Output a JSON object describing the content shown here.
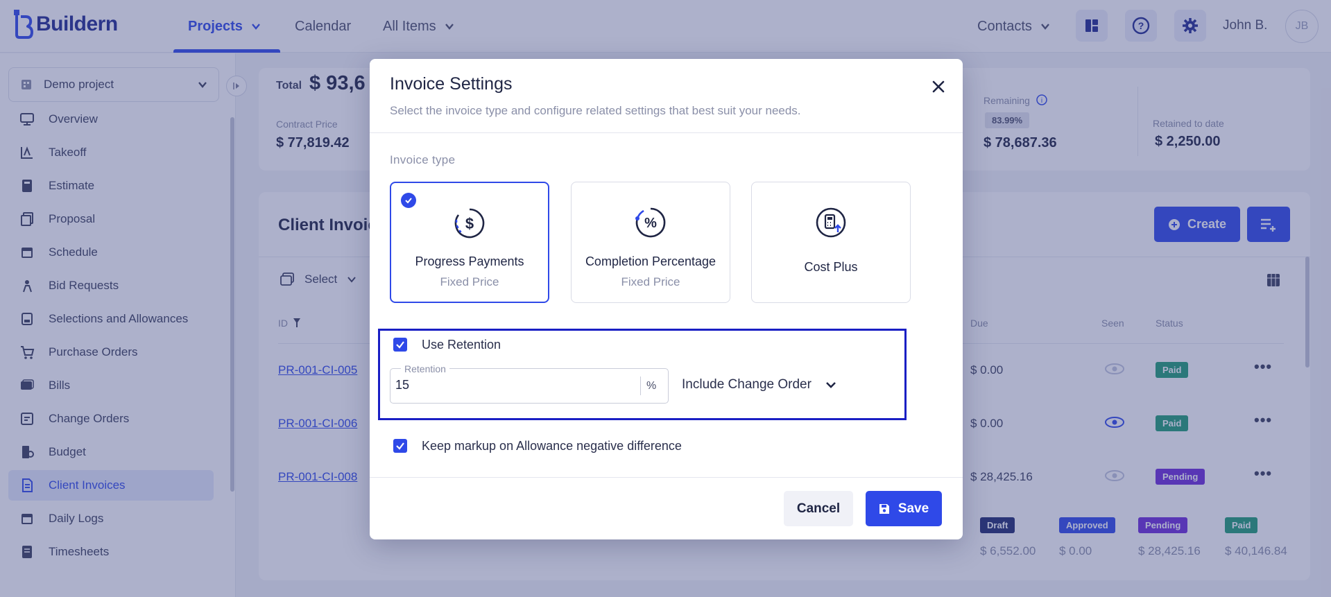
{
  "app": {
    "name": "Buildern"
  },
  "topnav": {
    "items": [
      {
        "label": "Projects"
      },
      {
        "label": "Calendar"
      },
      {
        "label": "All Items"
      }
    ],
    "contacts_label": "Contacts",
    "user_name": "John B.",
    "user_initials": "JB"
  },
  "sidebar": {
    "project_selector": "Demo project",
    "items": [
      {
        "label": "Overview",
        "icon": "monitor-icon"
      },
      {
        "label": "Takeoff",
        "icon": "ruler-icon"
      },
      {
        "label": "Estimate",
        "icon": "calculator-icon"
      },
      {
        "label": "Proposal",
        "icon": "document-stack-icon"
      },
      {
        "label": "Schedule",
        "icon": "calendar-icon"
      },
      {
        "label": "Bid Requests",
        "icon": "bid-icon"
      },
      {
        "label": "Selections and Allowances",
        "icon": "selection-icon"
      },
      {
        "label": "Purchase Orders",
        "icon": "cart-icon"
      },
      {
        "label": "Bills",
        "icon": "bill-icon"
      },
      {
        "label": "Change Orders",
        "icon": "change-icon"
      },
      {
        "label": "Budget",
        "icon": "budget-icon"
      },
      {
        "label": "Client Invoices",
        "icon": "invoice-icon"
      },
      {
        "label": "Daily Logs",
        "icon": "calendar-icon"
      },
      {
        "label": "Timesheets",
        "icon": "timesheet-icon"
      }
    ]
  },
  "summary": {
    "total_label": "Total",
    "total_value": "$ 93,6",
    "contract_price_label": "Contract Price",
    "contract_price_value": "$ 77,819.42",
    "remaining_label": "Remaining",
    "remaining_pct": "83.99%",
    "remaining_value": "$ 78,687.36",
    "retained_label": "Retained to date",
    "retained_value": "$ 2,250.00"
  },
  "invoices": {
    "title": "Client Invoic",
    "create_label": "Create",
    "select_label": "Select",
    "columns": {
      "id": "ID",
      "due": "Due",
      "seen": "Seen",
      "status": "Status"
    },
    "rows": [
      {
        "id": "PR-001-CI-005",
        "due": "$ 0.00",
        "status": "Paid"
      },
      {
        "id": "PR-001-CI-006",
        "due": "$ 0.00",
        "status": "Paid"
      },
      {
        "id": "PR-001-CI-008",
        "due": "$ 28,425.16",
        "status": "Pending"
      }
    ],
    "totals": [
      {
        "label": "Draft",
        "value": "$ 6,552.00"
      },
      {
        "label": "Approved",
        "value": "$ 0.00"
      },
      {
        "label": "Pending",
        "value": "$ 28,425.16"
      },
      {
        "label": "Paid",
        "value": "$ 40,146.84"
      }
    ]
  },
  "modal": {
    "title": "Invoice Settings",
    "subtitle": "Select the invoice type and configure related settings that best suit your needs.",
    "invoice_type_label": "Invoice type",
    "types": [
      {
        "name": "Progress Payments",
        "sub": "Fixed Price",
        "selected": true
      },
      {
        "name": "Completion Percentage",
        "sub": "Fixed Price",
        "selected": false
      },
      {
        "name": "Cost Plus",
        "sub": "",
        "selected": false
      }
    ],
    "use_retention_label": "Use Retention",
    "use_retention_checked": true,
    "retention_field_label": "Retention",
    "retention_value": "15",
    "retention_suffix": "%",
    "include_dropdown_value": "Include Change Order",
    "keep_markup_label": "Keep markup on Allowance negative difference",
    "keep_markup_checked": true,
    "cancel_label": "Cancel",
    "save_label": "Save"
  },
  "colors": {
    "accent": "#2f49e8",
    "highlight_border": "#1a1fc4",
    "badge_paid": "#1f9d74",
    "badge_pending": "#6d2bd9",
    "badge_draft": "#1f2a6e",
    "badge_approved": "#2f49e8"
  }
}
